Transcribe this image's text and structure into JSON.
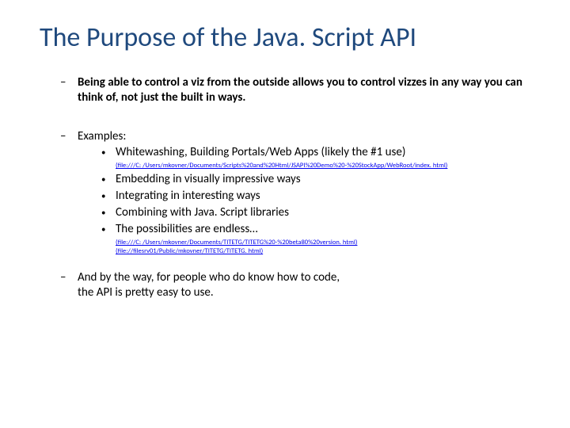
{
  "title": "The Purpose of the Java. Script API",
  "point1": {
    "text": "Being able to control a viz from the outside allows you to control vizzes in any way you can think of, not just the built in ways."
  },
  "point2": {
    "label": "Examples:",
    "items": [
      "Whitewashing, Building Portals/Web Apps (likely the #1 use)",
      "Embedding in visually impressive ways",
      "Integrating in interesting ways",
      "Combining with Java. Script libraries",
      "The possibilities are endless…"
    ],
    "link_after_0": "(file:///C: /Users/mkovner/Documents/Scripts%20and%20Html/JSAPI%20Demo%20-%20StockApp/WebRoot/index. html)",
    "links_after_4": [
      "(file:///C: /Users/mkovner/Documents/TITETG/TITETG%20-%20beta80%20version. html)",
      "(file://filesrv01/Public/mkovner/TITETG/TITETG. html)"
    ]
  },
  "point3": {
    "text": "And by the way, for people who do know how to code, the API is pretty easy to use."
  }
}
